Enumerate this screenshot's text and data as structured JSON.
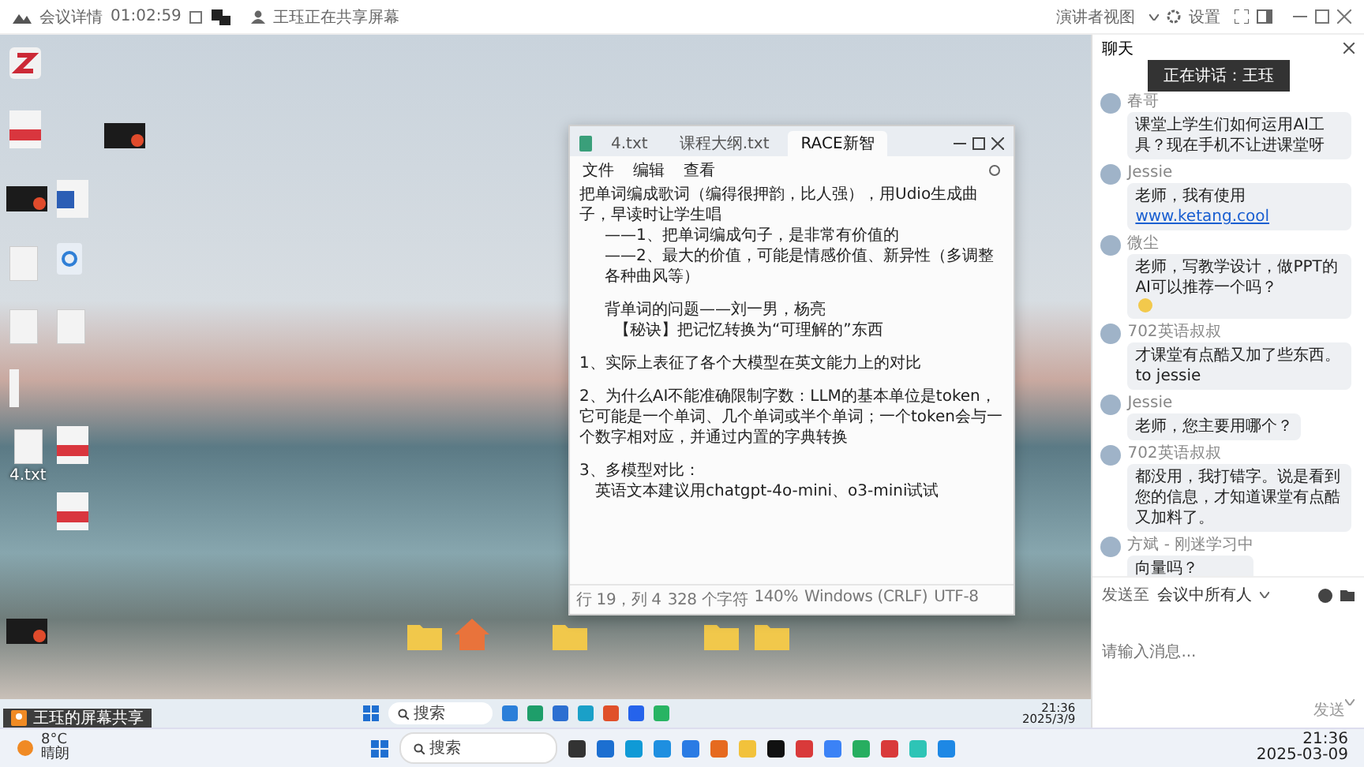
{
  "top_bar": {
    "meeting_label": "会议详情",
    "timer": "01:02:59",
    "sharing_notice": "王珏正在共享屏幕",
    "layout_button": "演讲者视图",
    "settings_button": "设置"
  },
  "desktop_icons": [
    {
      "kind": "zotero"
    },
    {
      "kind": "pdf"
    },
    {
      "kind": "video"
    },
    {
      "kind": "video"
    },
    {
      "kind": "word"
    },
    {
      "kind": "txt"
    },
    {
      "kind": "recycle"
    },
    {
      "kind": "txt"
    },
    {
      "kind": "txt"
    },
    {
      "kind": "bar"
    },
    {
      "kind": "txt",
      "label": "4.txt"
    },
    {
      "kind": "pdf"
    },
    {
      "kind": "pdf"
    },
    {
      "kind": "video"
    },
    {
      "kind": "folder"
    },
    {
      "kind": "app"
    },
    {
      "kind": "folder"
    },
    {
      "kind": "folder"
    },
    {
      "kind": "folder"
    }
  ],
  "notepad": {
    "tabs": [
      {
        "label": "4.txt",
        "selected": false
      },
      {
        "label": "课程大纲.txt",
        "selected": false
      },
      {
        "label": "RACE新智",
        "selected": true
      }
    ],
    "menu": [
      "文件",
      "编辑",
      "查看"
    ],
    "lines": [
      {
        "kind": "text",
        "text": "把单词编成歌词（编得很押韵，比人强），用Udio生成曲子，早读时让学生唱"
      },
      {
        "kind": "indent",
        "text": "——1、把单词编成句子，是非常有价值的"
      },
      {
        "kind": "indent",
        "text": "——2、最大的价值，可能是情感价值、新异性（多调整各种曲风等）"
      },
      {
        "kind": "blank"
      },
      {
        "kind": "indent",
        "text": "背单词的问题——刘一男，杨亮"
      },
      {
        "kind": "indent2",
        "text": "【秘诀】把记忆转换为“可理解的”东西"
      },
      {
        "kind": "blank"
      },
      {
        "kind": "text",
        "text": "1、实际上表征了各个大模型在英文能力上的对比"
      },
      {
        "kind": "blank"
      },
      {
        "kind": "text",
        "text": "2、为什么AI不能准确限制字数：LLM的基本单位是token，它可能是一个单词、几个单词或半个单词；一个token会与一个数字相对应，并通过内置的字典转换"
      },
      {
        "kind": "blank"
      },
      {
        "kind": "text",
        "text": "3、多模型对比："
      },
      {
        "kind": "indent1",
        "text": "英语文本建议用chatgpt-4o-mini、o3-mini试试"
      }
    ],
    "status": [
      "行 19，列 4",
      "328 个字符",
      "140%",
      "Windows (CRLF)",
      "UTF-8"
    ]
  },
  "inner_taskbar": {
    "search": "搜索",
    "time": "21:36",
    "date": "2025/3/9"
  },
  "share_tag": "王珏的屏幕共享",
  "chat": {
    "title": "聊天",
    "speaking": "正在讲话：王珏",
    "messages": [
      {
        "sender": "春哥",
        "text": "课堂上学生们如何运用AI工具？现在手机不让进课堂呀",
        "emoji": false
      },
      {
        "sender": "Jessie",
        "text": "老师，我有使用 ",
        "link": "www.ketang.cool",
        "emoji": false
      },
      {
        "sender": "微尘",
        "text": "老师，写教学设计，做PPT的AI可以推荐一个吗？",
        "emoji": true
      },
      {
        "sender": "702英语叔叔",
        "text": "才课堂有点酷又加了些东西。 to jessie",
        "emoji": false
      },
      {
        "sender": "Jessie",
        "text": "老师，您主要用哪个？",
        "emoji": false
      },
      {
        "sender": "702英语叔叔",
        "text": "都没用，我打错字。说是看到您的信息，才知道课堂有点酷又加料了。",
        "emoji": false
      },
      {
        "sender": "方斌 - 刚迷学习中",
        "text": "向量吗？",
        "emoji": false
      }
    ],
    "send_to_label": "发送至",
    "recipient": "会议中所有人",
    "placeholder": "请输入消息...",
    "send_button": "发送"
  },
  "outer_taskbar": {
    "temperature": "8°C",
    "weather": "晴朗",
    "search": "搜索",
    "time": "21:36",
    "date": "2025-03-09"
  }
}
